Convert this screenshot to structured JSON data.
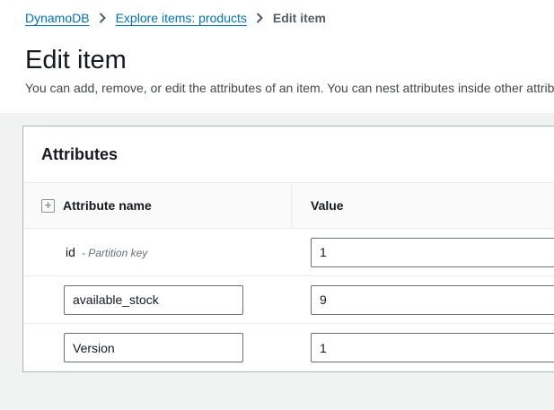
{
  "breadcrumb": {
    "items": [
      {
        "label": "DynamoDB",
        "type": "link"
      },
      {
        "label": "Explore items: products",
        "type": "link"
      },
      {
        "label": "Edit item",
        "type": "current"
      }
    ]
  },
  "page": {
    "title": "Edit item",
    "description": "You can add, remove, or edit the attributes of an item. You can nest attributes inside other attributes."
  },
  "panel": {
    "title": "Attributes",
    "table": {
      "columns": {
        "name": "Attribute name",
        "value": "Value"
      },
      "rows": [
        {
          "name": "id",
          "name_suffix": "- Partition key",
          "name_editable": false,
          "value": "1"
        },
        {
          "name": "available_stock",
          "name_editable": true,
          "value": "9"
        },
        {
          "name": "Version",
          "name_editable": true,
          "value": "1"
        }
      ]
    }
  },
  "icons": {
    "expand_all": "plus-square",
    "breadcrumb_separator": "chevron-right"
  },
  "colors": {
    "link": "#0073bb",
    "text": "#16191f",
    "secondary_text": "#687078",
    "breadcrumb_current": "#545b64",
    "page_background": "#f1f2f2",
    "panel_background": "#ffffff",
    "panel_border": "#aab7b8",
    "divider": "#eaeded",
    "table_header_background": "#fafafa",
    "input_border": "#687078"
  }
}
